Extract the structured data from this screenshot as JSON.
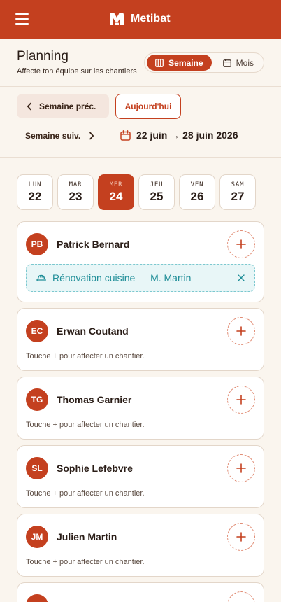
{
  "app": {
    "brand": "Metibat"
  },
  "header": {
    "title": "Planning",
    "subtitle": "Affecte ton équipe sur les chantiers",
    "view_toggle": {
      "week_label": "Semaine",
      "month_label": "Mois",
      "selected": "Semaine"
    }
  },
  "nav": {
    "prev_label": "Semaine préc.",
    "today_label": "Aujourd'hui",
    "next_label": "Semaine suiv.",
    "range_label": "22 juin → 28 juin 2026"
  },
  "days": [
    {
      "name": "LUN",
      "num": "22"
    },
    {
      "name": "MAR",
      "num": "23"
    },
    {
      "name": "MER",
      "num": "24",
      "active": true
    },
    {
      "name": "JEU",
      "num": "25"
    },
    {
      "name": "VEN",
      "num": "26"
    },
    {
      "name": "SAM",
      "num": "27"
    }
  ],
  "hint_text": "Touche + pour affecter un chantier.",
  "employees": [
    {
      "initials": "PB",
      "name": "Patrick Bernard",
      "assignment": "Rénovation cuisine — M. Martin"
    },
    {
      "initials": "EC",
      "name": "Erwan Coutand",
      "hint": "Touche + pour affecter un chantier."
    },
    {
      "initials": "TG",
      "name": "Thomas Garnier",
      "hint": "Touche + pour affecter un chantier."
    },
    {
      "initials": "SL",
      "name": "Sophie Lefebvre",
      "hint": "Touche + pour affecter un chantier."
    },
    {
      "initials": "JM",
      "name": "Julien Martin",
      "hint": "Touche + pour affecter un chantier."
    }
  ],
  "colors": {
    "brand": "#c4401f",
    "assignment": "#1f8e98",
    "background": "#faf5ee"
  }
}
